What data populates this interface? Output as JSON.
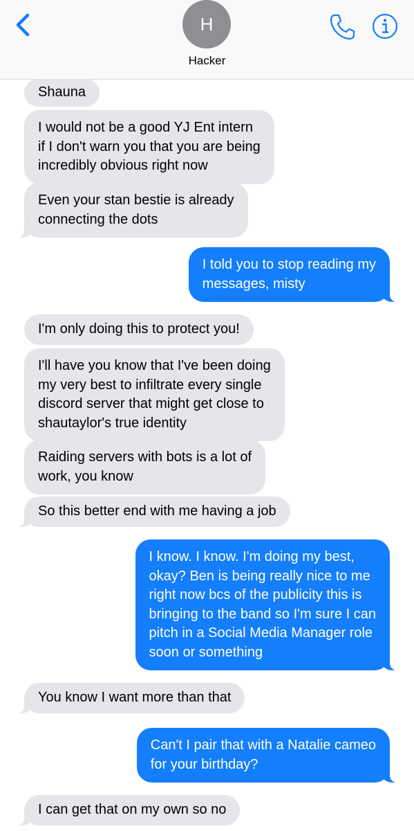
{
  "header": {
    "avatar_initial": "H",
    "contact_name": "Hacker"
  },
  "colors": {
    "accent": "#147efb",
    "incoming_bubble": "#e5e5ea",
    "avatar_bg": "#8e8e93"
  },
  "messages": [
    {
      "from": "them",
      "text": "Shauna"
    },
    {
      "from": "them",
      "text": "I would not be a good YJ Ent intern\nif I don't warn you that you are being\nincredibly obvious right now"
    },
    {
      "from": "them",
      "text": "Even your stan bestie is already\nconnecting the dots"
    },
    {
      "from": "me",
      "text": "I told you to stop reading my\nmessages, misty"
    },
    {
      "from": "them",
      "text": "I'm only doing this to protect you!"
    },
    {
      "from": "them",
      "text": "I'll have you know that I've been doing\nmy very best to infiltrate every single\ndiscord server that might get close to\nshautaylor's true identity"
    },
    {
      "from": "them",
      "text": "Raiding servers with bots is a lot of\nwork, you know"
    },
    {
      "from": "them",
      "text": "So this better end with me having a job"
    },
    {
      "from": "me",
      "text": "I know. I know. I'm doing my best,\nokay? Ben is being really nice to me\nright now bcs of the publicity this is\nbringing to the band so I'm sure I can\npitch in a Social Media Manager role\nsoon or something"
    },
    {
      "from": "them",
      "text": "You know I want more than that"
    },
    {
      "from": "me",
      "text": "Can't I pair that with a Natalie cameo\nfor your birthday?"
    },
    {
      "from": "them",
      "text": "I can get that on my own so no"
    }
  ]
}
